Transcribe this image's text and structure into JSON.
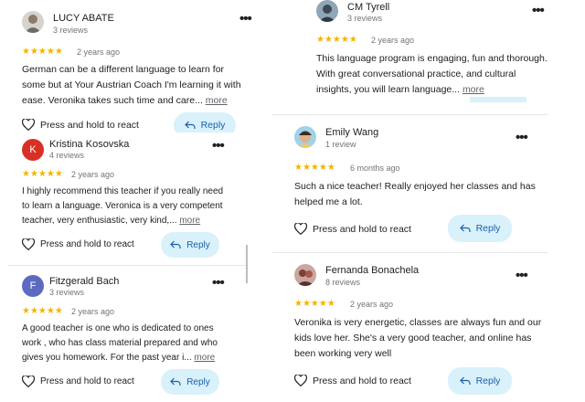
{
  "actions": {
    "react": "Press and hold to react",
    "reply": "Reply",
    "more": "more"
  },
  "reviews": [
    {
      "name": "LUCY ABATE",
      "sub": "3 reviews",
      "stars": "★★★★★",
      "date": "2 years ago",
      "text": "German can be a different language to learn for some but at Your Austrian Coach I'm learning it with ease. Veronika takes such time and care..."
    },
    {
      "name": "Kristina Kosovska",
      "sub": "4 reviews",
      "initial": "K",
      "stars": "★★★★★",
      "date": "2 years ago",
      "text": "I highly recommend this teacher if you really need to learn a language. Veronica is a very competent teacher, very enthusiastic, very kind,..."
    },
    {
      "name": "Fitzgerald Bach",
      "sub": "3 reviews",
      "initial": "F",
      "stars": "★★★★★",
      "date": "2 years ago",
      "text": "A good teacher is one who is dedicated to ones work , who has class material prepared and who gives you homework. For the past year i..."
    },
    {
      "name": "CM Tyrell",
      "sub": "3 reviews",
      "stars": "★★★★★",
      "date": "2 years ago",
      "text": "This language program is engaging, fun and thorough. With great conversational practice, and cultural insights, you will learn language..."
    },
    {
      "name": "Emily Wang",
      "sub": "1 review",
      "stars": "★★★★★",
      "date": "6 months ago",
      "text": "Such a nice teacher! Really enjoyed her classes and has helped me a lot."
    },
    {
      "name": "Fernanda Bonachela",
      "sub": "8 reviews",
      "stars": "★★★★★",
      "date": "2 years ago",
      "text": "Veronika is very energetic, classes are always fun and our kids love her. She's a very good teacher, and online has been working very well"
    }
  ],
  "colors": {
    "star": "#f4b400",
    "reply_bg": "#d9f1fb",
    "reply_text": "#1a5fa8",
    "avatar_k": "#d93025",
    "avatar_f": "#5c6bc0"
  }
}
